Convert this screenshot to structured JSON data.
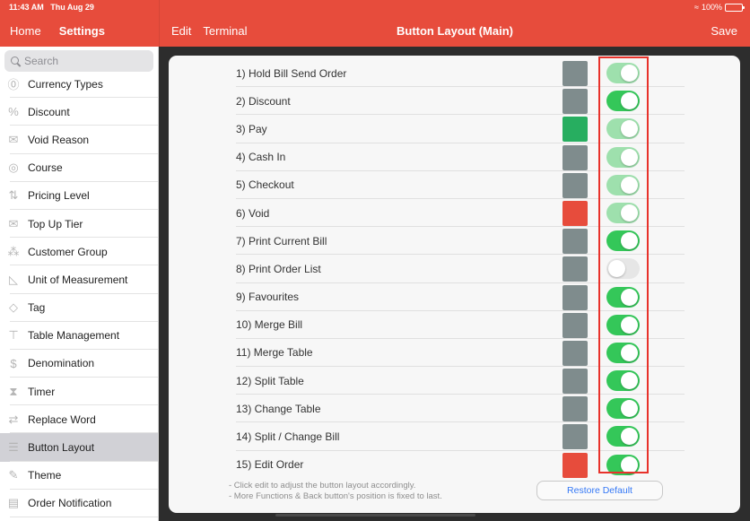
{
  "status_bar": {
    "time": "11:43 AM",
    "date": "Thu Aug 29",
    "wifi_icon": "wifi-icon",
    "battery": "100%"
  },
  "nav": {
    "home": "Home",
    "settings": "Settings",
    "edit": "Edit",
    "terminal": "Terminal",
    "title": "Button Layout (Main)",
    "save": "Save"
  },
  "sidebar": {
    "search_placeholder": "Search",
    "items": [
      {
        "label": "Currency Types",
        "icon": "currency-icon",
        "glyph": "⓪"
      },
      {
        "label": "Discount",
        "icon": "discount-icon",
        "glyph": "%"
      },
      {
        "label": "Void Reason",
        "icon": "void-reason-icon",
        "glyph": "✉"
      },
      {
        "label": "Course",
        "icon": "course-icon",
        "glyph": "◎"
      },
      {
        "label": "Pricing Level",
        "icon": "pricing-level-icon",
        "glyph": "⇅"
      },
      {
        "label": "Top Up Tier",
        "icon": "top-up-icon",
        "glyph": "✉"
      },
      {
        "label": "Customer Group",
        "icon": "customer-group-icon",
        "glyph": "⁂"
      },
      {
        "label": "Unit of Measurement",
        "icon": "ruler-icon",
        "glyph": "◺"
      },
      {
        "label": "Tag",
        "icon": "tag-icon",
        "glyph": "◇"
      },
      {
        "label": "Table Management",
        "icon": "table-icon",
        "glyph": "⊤"
      },
      {
        "label": "Denomination",
        "icon": "money-bag-icon",
        "glyph": "$"
      },
      {
        "label": "Timer",
        "icon": "hourglass-icon",
        "glyph": "⧗"
      },
      {
        "label": "Replace Word",
        "icon": "replace-word-icon",
        "glyph": "⇄"
      },
      {
        "label": "Button Layout",
        "icon": "list-icon",
        "glyph": "☰",
        "active": true
      },
      {
        "label": "Theme",
        "icon": "brush-icon",
        "glyph": "✎"
      },
      {
        "label": "Order Notification",
        "icon": "notification-icon",
        "glyph": "▤"
      }
    ]
  },
  "colors": {
    "brand_red": "#e74c3c",
    "swatch_gray": "#7f8c8d",
    "swatch_green": "#27ae60",
    "swatch_red": "#e74c3c",
    "toggle_on": "#34c759",
    "toggle_faded": "#9ee0ad",
    "toggle_off": "#e6e6e6",
    "link_blue": "#3478f6"
  },
  "buttons": [
    {
      "label": "1) Hold Bill Send Order",
      "color": "#7f8c8d",
      "enabled": true,
      "locked": true
    },
    {
      "label": "2) Discount",
      "color": "#7f8c8d",
      "enabled": true,
      "locked": false
    },
    {
      "label": "3) Pay",
      "color": "#27ae60",
      "enabled": true,
      "locked": true
    },
    {
      "label": "4) Cash In",
      "color": "#7f8c8d",
      "enabled": true,
      "locked": true
    },
    {
      "label": "5) Checkout",
      "color": "#7f8c8d",
      "enabled": true,
      "locked": true
    },
    {
      "label": "6) Void",
      "color": "#e74c3c",
      "enabled": true,
      "locked": true
    },
    {
      "label": "7) Print Current Bill",
      "color": "#7f8c8d",
      "enabled": true,
      "locked": false
    },
    {
      "label": "8) Print Order List",
      "color": "#7f8c8d",
      "enabled": false,
      "locked": false
    },
    {
      "label": "9) Favourites",
      "color": "#7f8c8d",
      "enabled": true,
      "locked": false
    },
    {
      "label": "10) Merge Bill",
      "color": "#7f8c8d",
      "enabled": true,
      "locked": false
    },
    {
      "label": "11) Merge Table",
      "color": "#7f8c8d",
      "enabled": true,
      "locked": false
    },
    {
      "label": "12) Split Table",
      "color": "#7f8c8d",
      "enabled": true,
      "locked": false
    },
    {
      "label": "13) Change Table",
      "color": "#7f8c8d",
      "enabled": true,
      "locked": false
    },
    {
      "label": "14) Split / Change Bill",
      "color": "#7f8c8d",
      "enabled": true,
      "locked": false
    },
    {
      "label": "15) Edit Order",
      "color": "#e74c3c",
      "enabled": true,
      "locked": false
    }
  ],
  "footer": {
    "note1": "- Click edit to adjust the button layout accordingly.",
    "note2": "- More Functions & Back button's position is fixed to last.",
    "restore_label": "Restore Default"
  }
}
